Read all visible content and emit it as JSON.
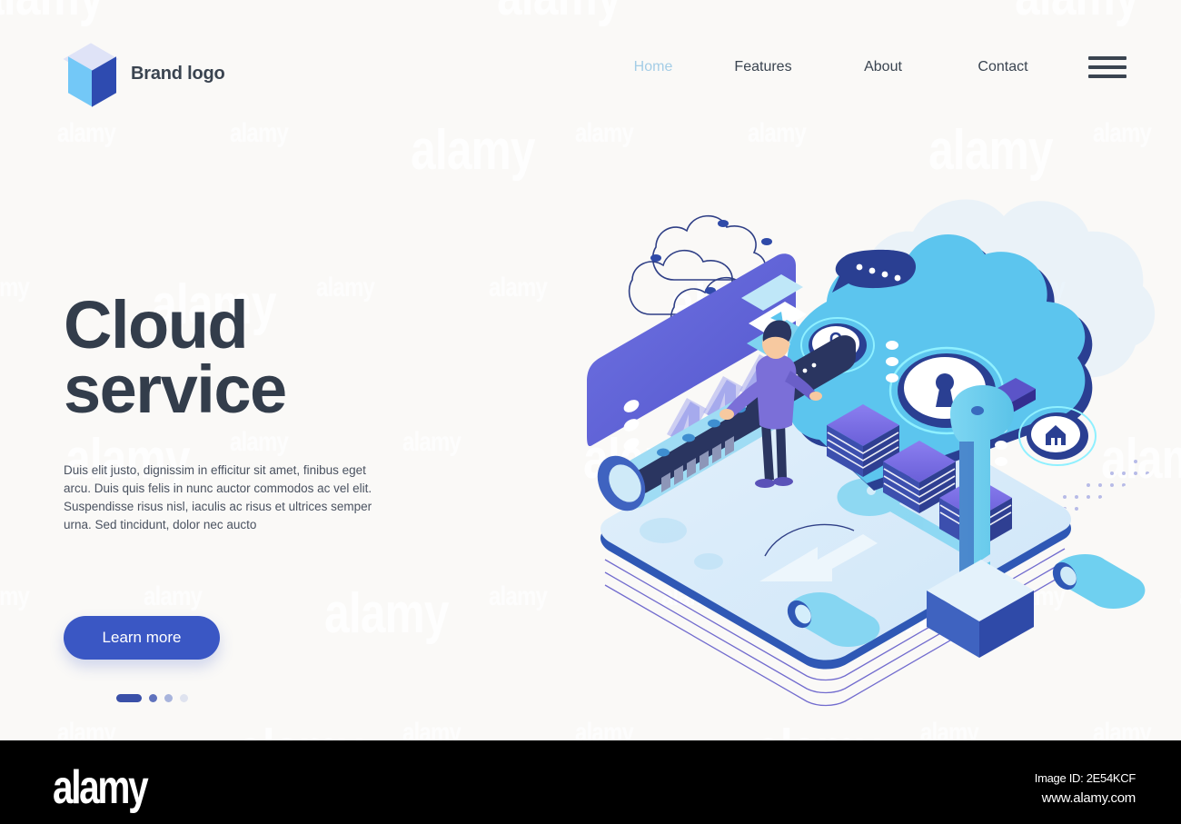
{
  "page": {
    "background_color": "#faf9f7",
    "watermark_text": "alamy"
  },
  "header": {
    "brand": {
      "logo_icon": "isometric-cube-icon",
      "name": "Brand logo",
      "colors": {
        "top": "#dfe3f7",
        "left": "#73c8f7",
        "right": "#2e4bb0"
      }
    },
    "nav": {
      "items": [
        {
          "label": "Home",
          "active": true
        },
        {
          "label": "Features",
          "active": false
        },
        {
          "label": "About",
          "active": false
        },
        {
          "label": "Contact",
          "active": false
        }
      ],
      "active_color": "#a4cde6",
      "inactive_color": "#3a4450",
      "menu_icon": "hamburger-menu-icon"
    }
  },
  "hero": {
    "headline": "Cloud\nservice",
    "headline_color": "#333d4b",
    "paragraph": "Duis elit justo, dignissim in efficitur sit amet, finibus eget arcu. Duis quis felis in nunc auctor commodos ac vel elit. Suspendisse risus nisl, iaculis ac risus et ultrices semper urna. Sed tincidunt, dolor nec aucto",
    "cta_label": "Learn more",
    "cta_color": "#3a57c4",
    "carousel": {
      "slide_count": 4,
      "active_index": 0,
      "dot_colors": [
        "#3a50a8",
        "#5f72bd",
        "#a8b4dc",
        "#dfe3ef"
      ]
    }
  },
  "illustration": {
    "name": "cloud-service-isometric-illustration",
    "elements": [
      "wireframe-cloud-network",
      "halftone-dot-pattern",
      "purple-dashboard-screen",
      "upward-arrows",
      "cyan-chart-panels",
      "server-cylinder",
      "character-worker",
      "isometric-platform",
      "sky-blue-cloud",
      "padlock-badge",
      "keyhole-badge",
      "bank-building-badge",
      "chat-bubble",
      "stacked-server-blocks",
      "giant-key",
      "key-base-block",
      "small-cylinder"
    ],
    "palette": {
      "cloud_blue": "#5cc5ee",
      "cloud_outline": "#2a3f92",
      "screen_purple": "#6063d8",
      "screen_purple_dark": "#4f52c4",
      "platform_light": "#d4e8f8",
      "platform_edge": "#2f58b5",
      "key_cyan": "#6fd0f0",
      "server_purple": "#7b6fe0",
      "arrow_light": "#9a9ee8",
      "character_jacket": "#7b6fd8",
      "character_pants": "#2a3560",
      "character_skin": "#f7c9a0"
    }
  },
  "footer": {
    "logo_text": "alamy",
    "image_id_label": "Image ID: 2E54KCF",
    "website": "www.alamy.com",
    "background": "#000000"
  }
}
